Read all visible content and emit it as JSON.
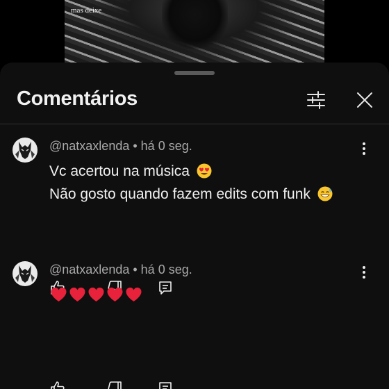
{
  "video": {
    "caption": "mas deixe"
  },
  "sheet": {
    "title": "Comentários"
  },
  "comments": [
    {
      "author": "@natxaxlenda",
      "separator": " • ",
      "time": "há 0 seg.",
      "lines": [
        "Vc acertou na música",
        "Não gosto quando fazem edits com funk"
      ],
      "line_emojis": [
        "heart-eyes-emoji",
        "sweat-smile-emoji"
      ]
    },
    {
      "author": "@natxaxlenda",
      "separator": " • ",
      "time": "há 0 seg.",
      "hearts": 5,
      "heart_color": "#e8223a"
    }
  ],
  "icons": {
    "filter": "filter-sliders-icon",
    "close": "close-icon",
    "more": "more-vert-icon",
    "like": "thumb-up-icon",
    "dislike": "thumb-down-icon",
    "reply": "reply-icon"
  },
  "colors": {
    "sheet_bg": "#0f0f0f",
    "meta_text": "#aaaaaa",
    "text": "#f1f1f1"
  }
}
